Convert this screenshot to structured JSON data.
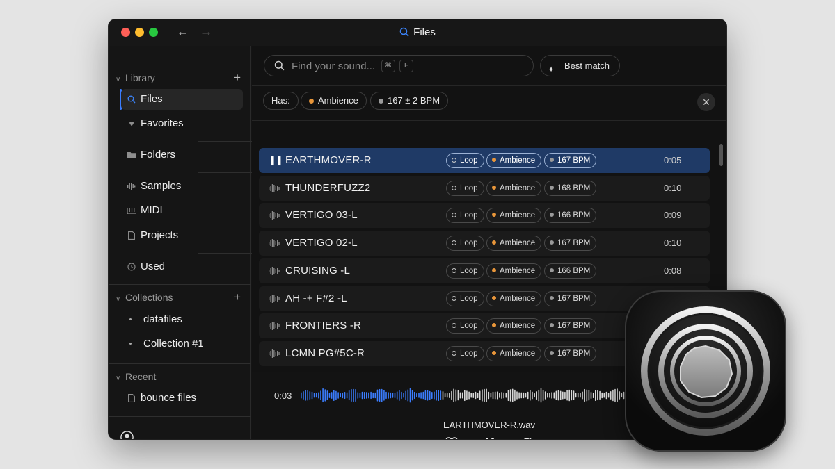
{
  "window": {
    "title": "Files"
  },
  "sidebar": {
    "library": {
      "header": "Library",
      "items": [
        {
          "label": "Files",
          "icon": "search-icon"
        },
        {
          "label": "Favorites",
          "icon": "heart-icon"
        },
        {
          "label": "Folders",
          "icon": "folder-icon"
        },
        {
          "label": "Samples",
          "icon": "waveform-icon"
        },
        {
          "label": "MIDI",
          "icon": "piano-icon"
        },
        {
          "label": "Projects",
          "icon": "document-icon"
        },
        {
          "label": "Used",
          "icon": "clock-icon"
        }
      ]
    },
    "collections": {
      "header": "Collections",
      "items": [
        {
          "label": "datafiles"
        },
        {
          "label": "Collection #1"
        }
      ]
    },
    "recent": {
      "header": "Recent",
      "items": [
        {
          "label": "bounce files",
          "icon": "document-icon"
        }
      ]
    }
  },
  "search": {
    "placeholder": "Find your sound...",
    "kbd1": "⌘",
    "kbd2": "F"
  },
  "sort_button": {
    "label": "Best match"
  },
  "filters": {
    "has_label": "Has:",
    "chips": [
      {
        "label": "Ambience",
        "color": "#e8963a"
      },
      {
        "label": "167 ± 2 BPM",
        "color": "#9a9a9a"
      }
    ]
  },
  "files": [
    {
      "name": "EARTHMOVER-R",
      "loop": "Loop",
      "tag": "Ambience",
      "bpm": "167 BPM",
      "duration": "0:05",
      "selected": true
    },
    {
      "name": "THUNDERFUZZ2",
      "loop": "Loop",
      "tag": "Ambience",
      "bpm": "168 BPM",
      "duration": "0:10"
    },
    {
      "name": "VERTIGO 03-L",
      "loop": "Loop",
      "tag": "Ambience",
      "bpm": "166 BPM",
      "duration": "0:09"
    },
    {
      "name": "VERTIGO 02-L",
      "loop": "Loop",
      "tag": "Ambience",
      "bpm": "167 BPM",
      "duration": "0:10"
    },
    {
      "name": "CRUISING -L",
      "loop": "Loop",
      "tag": "Ambience",
      "bpm": "166 BPM",
      "duration": "0:08"
    },
    {
      "name": "AH -+ F#2 -L",
      "loop": "Loop",
      "tag": "Ambience",
      "bpm": "167 BPM",
      "duration": "0:12"
    },
    {
      "name": "FRONTIERS -R",
      "loop": "Loop",
      "tag": "Ambience",
      "bpm": "167 BPM",
      "duration": ""
    },
    {
      "name": "LCMN PG#5C-R",
      "loop": "Loop",
      "tag": "Ambience",
      "bpm": "167 BPM",
      "duration": ""
    }
  ],
  "player": {
    "current_time": "0:03",
    "file_name": "EARTHMOVER-R.wav",
    "progress": 0.43,
    "volume": 0.8
  },
  "colors": {
    "accent": "#3b7dff",
    "selected_row": "#1f3a66",
    "ambience": "#e8963a"
  }
}
